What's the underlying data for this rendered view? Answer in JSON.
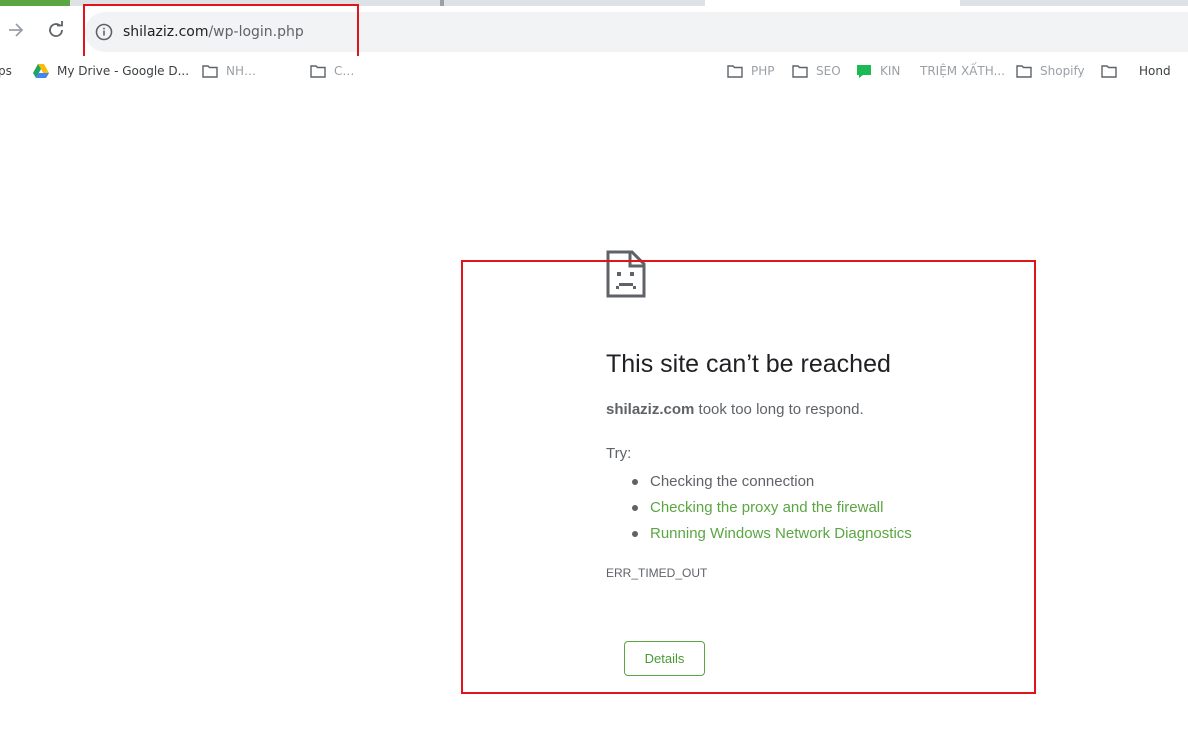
{
  "browser": {
    "address_bar": {
      "host": "shilaziz.com",
      "path": "/wp-login.php"
    },
    "bookmarks": [
      {
        "label": "ps",
        "icon": "apps-icon"
      },
      {
        "label": "My Drive - Google D...",
        "icon": "google-drive-icon"
      },
      {
        "label": "NH…",
        "icon": "folder-icon"
      },
      {
        "label": "C…",
        "icon": "folder-icon"
      },
      {
        "label": "PHP",
        "icon": "folder-icon"
      },
      {
        "label": "SEO",
        "icon": "folder-icon"
      },
      {
        "label": "KIN",
        "icon": "chat-icon"
      },
      {
        "label": "TRIỆM XẤTH...",
        "icon": "none"
      },
      {
        "label": "Shopify",
        "icon": "folder-icon"
      },
      {
        "label": "Hond",
        "icon": "folder-icon"
      }
    ]
  },
  "error_page": {
    "title": "This site can’t be reached",
    "summary_host": "shilaziz.com",
    "summary_rest": " took too long to respond.",
    "try_label": "Try:",
    "suggestions": [
      {
        "text": "Checking the connection",
        "is_link": false
      },
      {
        "text": "Checking the proxy and the firewall",
        "is_link": true
      },
      {
        "text": "Running Windows Network Diagnostics",
        "is_link": true
      }
    ],
    "error_code": "ERR_TIMED_OUT",
    "details_button": "Details"
  },
  "colors": {
    "link": "#5aa642",
    "highlight_box": "#e0141b",
    "text_secondary": "#5f6368"
  }
}
